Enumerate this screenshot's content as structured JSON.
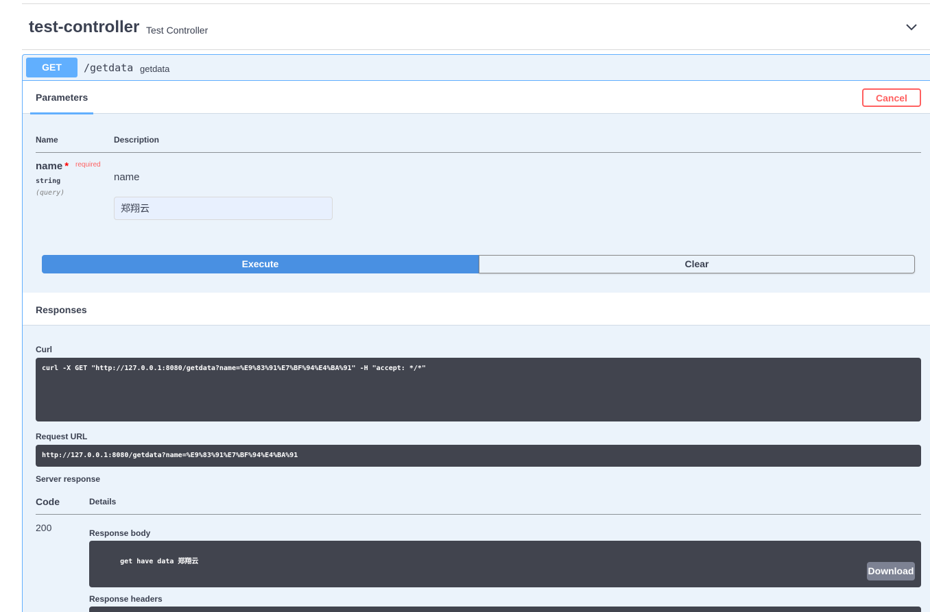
{
  "tag": {
    "name": "test-controller",
    "description": "Test Controller",
    "toggle_icon": "chevron-down-icon"
  },
  "operation": {
    "method": "GET",
    "path": "/getdata",
    "summary": "getdata"
  },
  "parameters": {
    "tab_label": "Parameters",
    "cancel_label": "Cancel",
    "columns": {
      "name": "Name",
      "description": "Description"
    },
    "items": [
      {
        "name": "name",
        "required_mark": "*",
        "required_label": "required",
        "type": "string",
        "in": "(query)",
        "description": "name",
        "value": "郑翔云"
      }
    ]
  },
  "actions": {
    "execute_label": "Execute",
    "clear_label": "Clear"
  },
  "responses": {
    "title": "Responses",
    "curl_label": "Curl",
    "curl_command": "curl -X GET \"http://127.0.0.1:8080/getdata?name=%E9%83%91%E7%BF%94%E4%BA%91\" -H \"accept: */*\"",
    "request_url_label": "Request URL",
    "request_url": "http://127.0.0.1:8080/getdata?name=%E9%83%91%E7%BF%94%E4%BA%91",
    "server_response_label": "Server response",
    "code_header": "Code",
    "details_header": "Details",
    "code": "200",
    "body_label": "Response body",
    "body": "get have data 郑翔云",
    "download_label": "Download",
    "headers_label": "Response headers"
  },
  "colors": {
    "get_accent": "#61affe",
    "execute": "#4990e2",
    "cancel": "#ff6060",
    "code_bg": "#41444e",
    "opblock_bg": "#ebf3fb"
  }
}
